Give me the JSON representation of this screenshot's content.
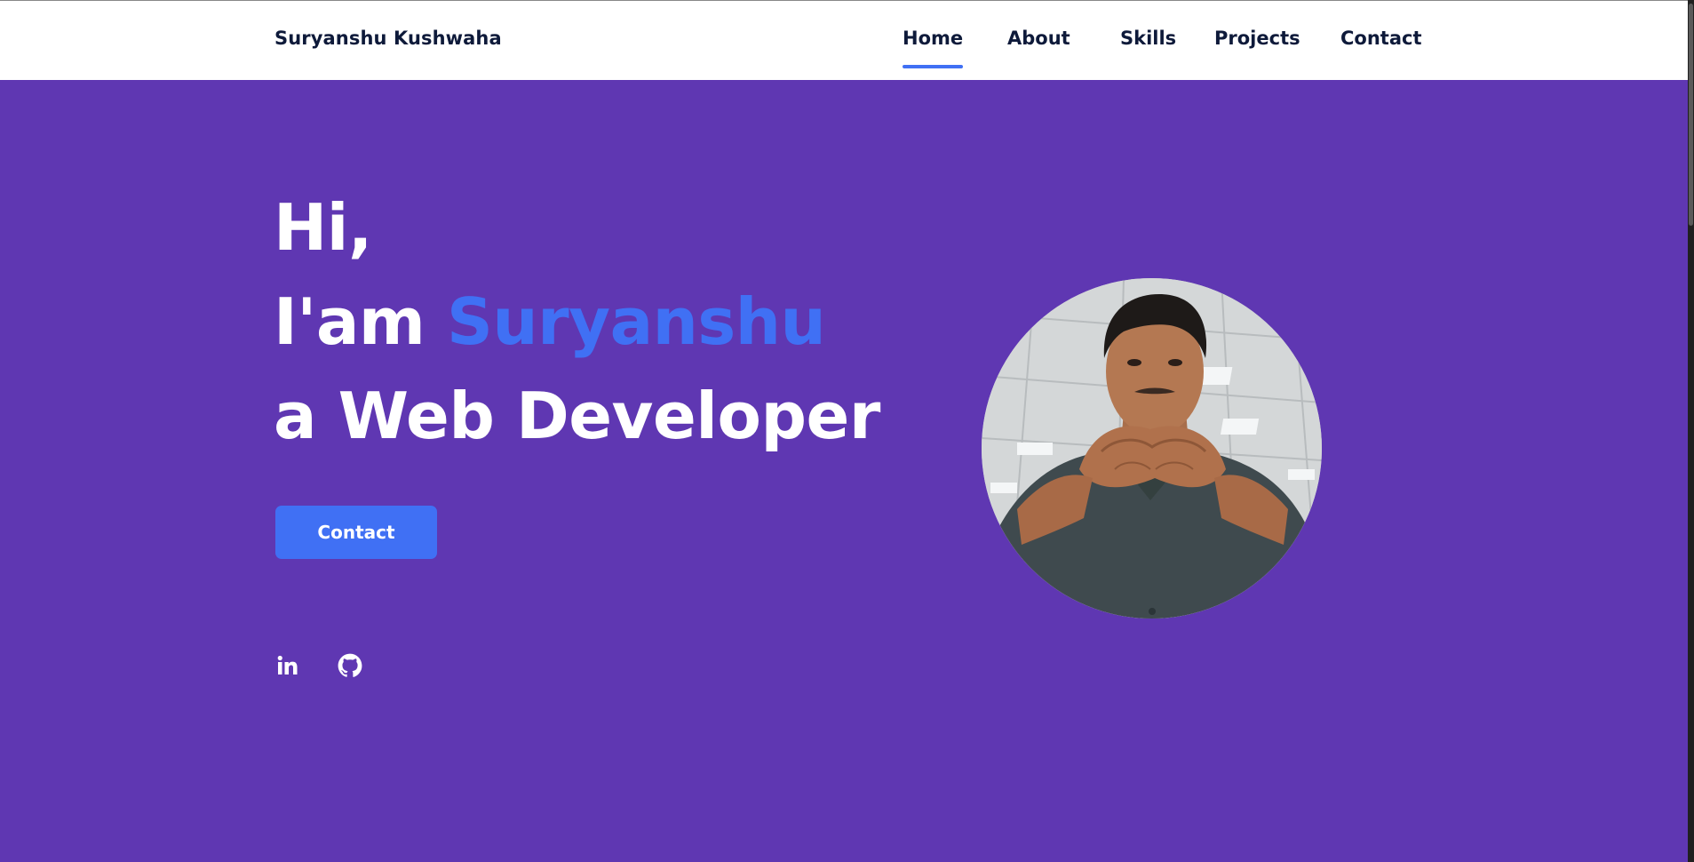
{
  "header": {
    "logo": "Suryanshu Kushwaha",
    "nav": [
      {
        "label": "Home",
        "active": true
      },
      {
        "label": "About",
        "active": false
      },
      {
        "label": "Skills",
        "active": false
      },
      {
        "label": "Projects",
        "active": false
      },
      {
        "label": "Contact",
        "active": false
      }
    ]
  },
  "hero": {
    "greeting": "Hi,",
    "intro_prefix": "I'am",
    "name": "Suryanshu",
    "role_line": "a Web Developer",
    "contact_button": "Contact",
    "socials": [
      {
        "icon": "linkedin-icon"
      },
      {
        "icon": "github-icon"
      }
    ]
  },
  "colors": {
    "background": "#5f37b2",
    "accent": "#4070f4",
    "header_bg": "#ffffff",
    "nav_text": "#0e1a3a"
  }
}
